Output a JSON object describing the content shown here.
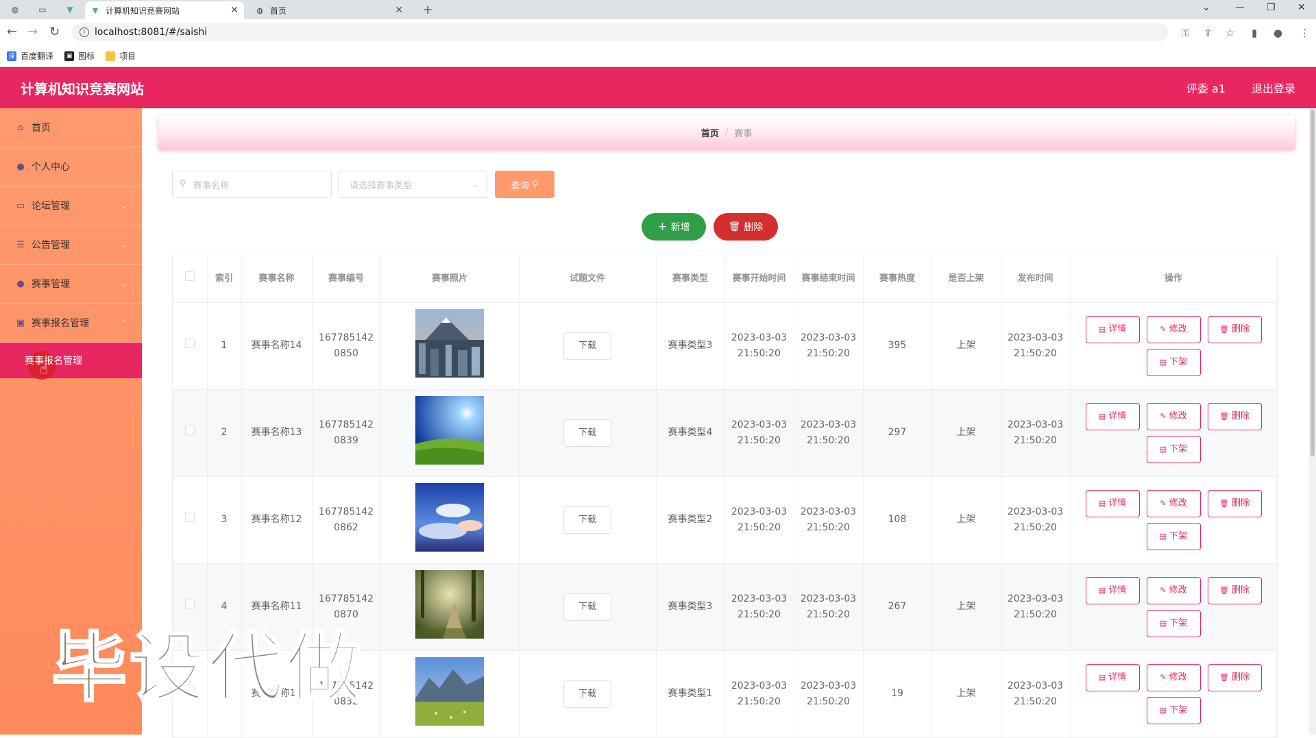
{
  "browser": {
    "tabs": [
      {
        "title": "计算机知识竞赛网站",
        "favicon": "vue-logo-icon",
        "active": true
      },
      {
        "title": "首页",
        "favicon": "globe-icon",
        "active": false
      }
    ],
    "url": "localhost:8081/#/saishi",
    "bookmarks": [
      "百度翻译",
      "图标",
      "项目"
    ]
  },
  "header": {
    "title": "计算机知识竞赛网站",
    "user": "评委 a1",
    "logout": "退出登录",
    "color": "#e8265f"
  },
  "sidebar": {
    "items": [
      {
        "label": "首页",
        "icon": "home-icon",
        "has_chevron": false
      },
      {
        "label": "个人中心",
        "icon": "user-icon",
        "has_chevron": false
      },
      {
        "label": "论坛管理",
        "icon": "forum-icon",
        "has_chevron": true
      },
      {
        "label": "公告管理",
        "icon": "list-icon",
        "has_chevron": true
      },
      {
        "label": "赛事管理",
        "icon": "user-icon",
        "has_chevron": true
      },
      {
        "label": "赛事报名管理",
        "icon": "picture-icon",
        "has_chevron": true,
        "expanded": true
      }
    ],
    "subitem": "赛事报名管理"
  },
  "breadcrumb": {
    "home": "首页",
    "separator": "/",
    "current": "赛事"
  },
  "search": {
    "name_placeholder": "赛事名称",
    "type_placeholder": "请选择赛事类型",
    "query_label": "查询"
  },
  "actions": {
    "add_label": "新增",
    "delete_label": "删除"
  },
  "table": {
    "headers": [
      "索引",
      "赛事名称",
      "赛事编号",
      "赛事照片",
      "试题文件",
      "赛事类型",
      "赛事开始时间",
      "赛事结束时间",
      "赛事热度",
      "是否上架",
      "发布时间",
      "操作"
    ],
    "download_label": "下载",
    "op_labels": {
      "detail": "详情",
      "edit": "修改",
      "delete": "删除",
      "offshelf": "下架"
    },
    "rows": [
      {
        "index": "1",
        "name": "赛事名称14",
        "code": "1677851420850",
        "photo": "city-mountain",
        "type": "赛事类型3",
        "start": "2023-03-03 21:50:20",
        "end": "2023-03-03 21:50:20",
        "heat": "395",
        "status": "上架",
        "published": "2023-03-03 21:50:20"
      },
      {
        "index": "2",
        "name": "赛事名称13",
        "code": "1677851420839",
        "photo": "sun-meadow",
        "type": "赛事类型4",
        "start": "2023-03-03 21:50:20",
        "end": "2023-03-03 21:50:20",
        "heat": "297",
        "status": "上架",
        "published": "2023-03-03 21:50:20"
      },
      {
        "index": "3",
        "name": "赛事名称12",
        "code": "1677851420862",
        "photo": "blue-sky-clouds",
        "type": "赛事类型2",
        "start": "2023-03-03 21:50:20",
        "end": "2023-03-03 21:50:20",
        "heat": "108",
        "status": "上架",
        "published": "2023-03-03 21:50:20"
      },
      {
        "index": "4",
        "name": "赛事名称11",
        "code": "1677851420870",
        "photo": "forest-path",
        "type": "赛事类型3",
        "start": "2023-03-03 21:50:20",
        "end": "2023-03-03 21:50:20",
        "heat": "267",
        "status": "上架",
        "published": "2023-03-03 21:50:20"
      },
      {
        "index": "5",
        "name": "赛事名称10",
        "code": "1677851420832",
        "photo": "mountain-field",
        "type": "赛事类型1",
        "start": "2023-03-03 21:50:20",
        "end": "2023-03-03 21:50:20",
        "heat": "19",
        "status": "上架",
        "published": "2023-03-03 21:50:20"
      }
    ]
  },
  "watermark": "毕设代做"
}
